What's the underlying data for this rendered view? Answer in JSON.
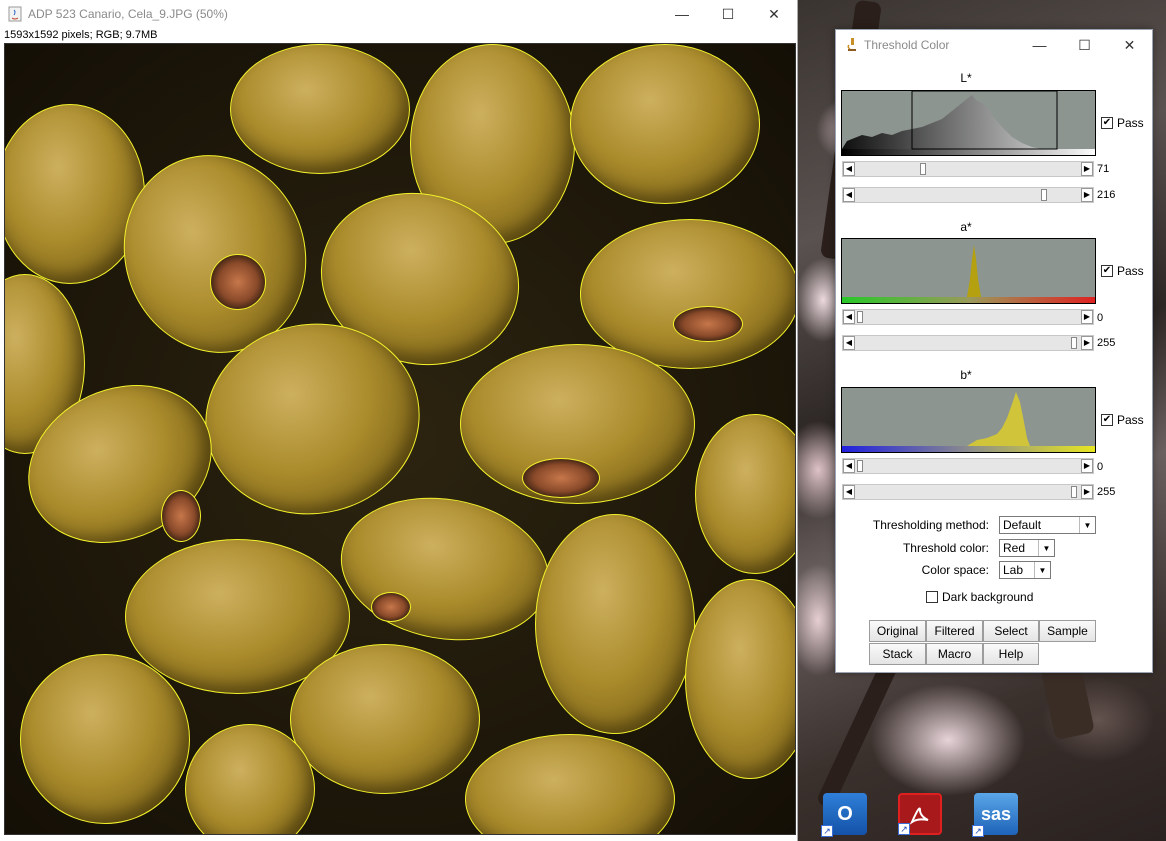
{
  "image_window": {
    "title": "ADP 523 Canario, Cela_9.JPG (50%)",
    "info": "1593x1592 pixels; RGB; 9.7MB",
    "controls": {
      "minimize": "—",
      "maximize": "☐",
      "close": "✕"
    }
  },
  "threshold_window": {
    "title": "Threshold Color",
    "controls": {
      "minimize": "—",
      "maximize": "☐",
      "close": "✕"
    },
    "channels": [
      {
        "label": "L*",
        "pass_label": "Pass",
        "pass_checked": true,
        "min_value": "71",
        "max_value": "216"
      },
      {
        "label": "a*",
        "pass_label": "Pass",
        "pass_checked": true,
        "min_value": "0",
        "max_value": "255"
      },
      {
        "label": "b*",
        "pass_label": "Pass",
        "pass_checked": true,
        "min_value": "0",
        "max_value": "255"
      }
    ],
    "form": {
      "method_label": "Thresholding method:",
      "method_value": "Default",
      "color_label": "Threshold color:",
      "color_value": "Red",
      "space_label": "Color space:",
      "space_value": "Lab",
      "dark_bg_label": "Dark background",
      "dark_bg_checked": false
    },
    "buttons_row1": [
      "Original",
      "Filtered",
      "Select",
      "Sample"
    ],
    "buttons_row2": [
      "Stack",
      "Macro",
      "Help"
    ]
  },
  "desktop_shortcuts": [
    {
      "name": "outlook",
      "label": "O"
    },
    {
      "name": "acrobat",
      "label": ""
    },
    {
      "name": "sas",
      "label": "sas"
    }
  ]
}
